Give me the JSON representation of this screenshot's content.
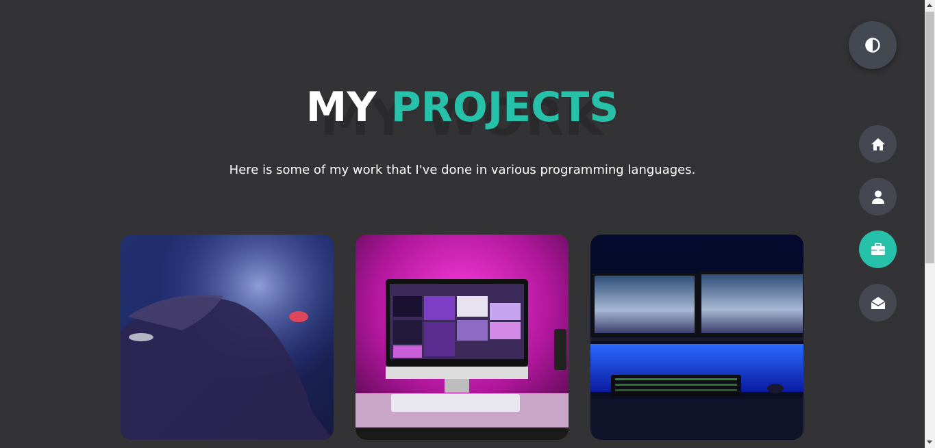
{
  "heading": {
    "background_word": "MY WORK",
    "title_part1": "MY",
    "title_part2": "PROJECTS"
  },
  "subtitle": "Here is some of my work that I've done in various programming languages.",
  "theme_toggle": {
    "icon": "contrast-icon"
  },
  "nav": [
    {
      "name": "home",
      "icon": "home-icon",
      "active": false
    },
    {
      "name": "about",
      "icon": "user-icon",
      "active": false
    },
    {
      "name": "portfolio",
      "icon": "briefcase-icon",
      "active": true
    },
    {
      "name": "contact",
      "icon": "envelope-icon",
      "active": false
    }
  ],
  "projects": [
    {
      "image": "hand-on-keyboard-photo"
    },
    {
      "image": "pink-desk-setup-photo"
    },
    {
      "image": "dual-monitor-setup-photo"
    }
  ],
  "colors": {
    "background": "#333336",
    "accent": "#27c1a9",
    "button": "#454850",
    "text": "#ffffff"
  }
}
